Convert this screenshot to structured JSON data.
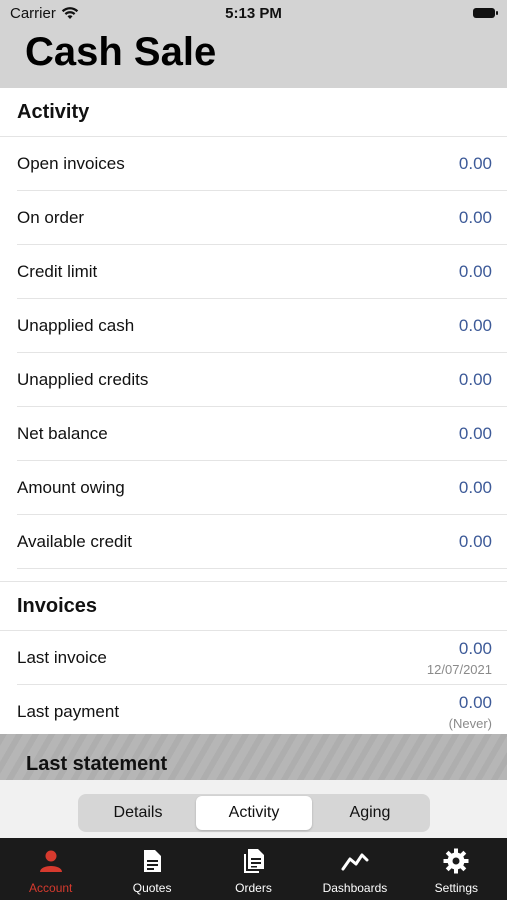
{
  "status": {
    "carrier": "Carrier",
    "time": "5:13 PM"
  },
  "header": {
    "title": "Cash Sale"
  },
  "activity": {
    "title": "Activity",
    "rows": [
      {
        "label": "Open invoices",
        "value": "0.00"
      },
      {
        "label": "On order",
        "value": "0.00"
      },
      {
        "label": "Credit limit",
        "value": "0.00"
      },
      {
        "label": "Unapplied cash",
        "value": "0.00"
      },
      {
        "label": "Unapplied credits",
        "value": "0.00"
      },
      {
        "label": "Net balance",
        "value": "0.00"
      },
      {
        "label": "Amount owing",
        "value": "0.00"
      },
      {
        "label": "Available credit",
        "value": "0.00"
      }
    ]
  },
  "invoices": {
    "title": "Invoices",
    "rows": [
      {
        "label": "Last invoice",
        "value": "0.00",
        "sub": "12/07/2021"
      },
      {
        "label": "Last payment",
        "value": "0.00",
        "sub": "(Never)"
      }
    ]
  },
  "statement": {
    "title": "Last statement"
  },
  "segment": {
    "items": [
      "Details",
      "Activity",
      "Aging"
    ],
    "selected": "Activity"
  },
  "tabbar": {
    "items": [
      {
        "label": "Account",
        "icon": "person-icon"
      },
      {
        "label": "Quotes",
        "icon": "document-icon"
      },
      {
        "label": "Orders",
        "icon": "documents-icon"
      },
      {
        "label": "Dashboards",
        "icon": "trend-icon"
      },
      {
        "label": "Settings",
        "icon": "gear-icon"
      }
    ],
    "active": "Account"
  },
  "colors": {
    "accent": "#d63a2e",
    "value_blue": "#3d5a98",
    "header_bg": "#d3d3d3",
    "tabbar_bg": "#1b1b1b"
  }
}
